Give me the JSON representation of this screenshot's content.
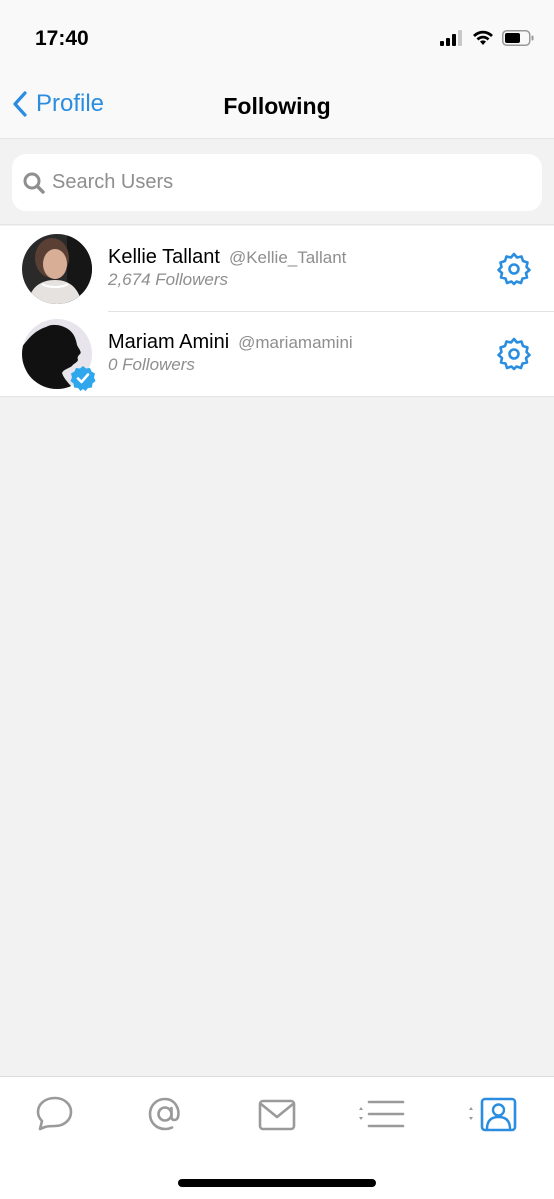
{
  "status_bar": {
    "time": "17:40"
  },
  "nav": {
    "back_label": "Profile",
    "title": "Following"
  },
  "search": {
    "placeholder": "Search Users",
    "value": ""
  },
  "users": [
    {
      "name": "Kellie Tallant",
      "handle": "@Kellie_Tallant",
      "followers": "2,674 Followers",
      "verified": false,
      "avatar": "photo"
    },
    {
      "name": "Mariam Amini",
      "handle": "@mariamamini",
      "followers": "0 Followers",
      "verified": true,
      "avatar": "silhouette"
    }
  ],
  "tabbar": {
    "items": [
      {
        "icon": "speech-bubble-icon",
        "active": false
      },
      {
        "icon": "at-sign-icon",
        "active": false
      },
      {
        "icon": "envelope-icon",
        "active": false
      },
      {
        "icon": "list-icon",
        "active": false
      },
      {
        "icon": "profile-icon",
        "active": true
      }
    ]
  },
  "colors": {
    "accent": "#2b8de0",
    "inactive": "#9a9a9a",
    "background": "#f2f2f2"
  }
}
